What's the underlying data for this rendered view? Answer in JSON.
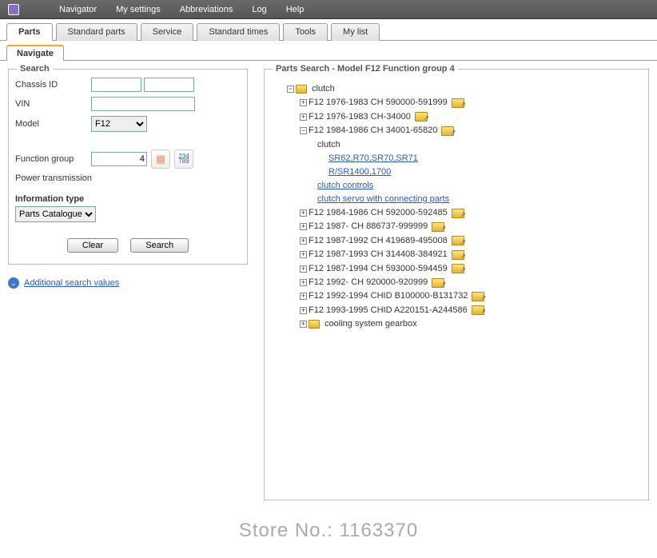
{
  "topMenu": [
    "Navigator",
    "My settings",
    "Abbreviations",
    "Log",
    "Help"
  ],
  "mainTabs": [
    {
      "label": "Parts",
      "active": true
    },
    {
      "label": "Standard parts"
    },
    {
      "label": "Service"
    },
    {
      "label": "Standard times"
    },
    {
      "label": "Tools"
    },
    {
      "label": "My list"
    }
  ],
  "subTabs": [
    {
      "label": "Navigate",
      "active": true
    }
  ],
  "search": {
    "legend": "Search",
    "chassisLabel": "Chassis ID",
    "chassisA": "",
    "chassisB": "",
    "vinLabel": "VIN",
    "vinValue": "",
    "modelLabel": "Model",
    "modelValue": "F12",
    "funcGroupLabel": "Function group",
    "funcGroupValue": "4",
    "funcGroupDesc": "Power transmission",
    "infoTypeLabel": "Information type",
    "infoTypeValue": "Parts Catalogue",
    "clearBtn": "Clear",
    "searchBtn": "Search",
    "additionalLink": "Additional search values"
  },
  "partsSearch": {
    "title": "Parts Search - Model F12 Function group 4",
    "root": "clutch",
    "nodes": [
      {
        "exp": "+",
        "label": "F12 1976-1983 CH 590000-591999",
        "trail": true
      },
      {
        "exp": "+",
        "label": "F12 1976-1983 CH-34000",
        "trail": true
      },
      {
        "exp": "-",
        "label": "F12 1984-1986 CH 34001-65820",
        "trail": true,
        "children": {
          "heading": "clutch",
          "links": [
            "SR62,R70,SR70,SR71",
            "R/SR1400,1700"
          ],
          "sub": [
            "clutch controls",
            "clutch servo with connecting parts"
          ]
        }
      },
      {
        "exp": "+",
        "label": "F12 1984-1986 CH 592000-592485",
        "trail": true
      },
      {
        "exp": "+",
        "label": "F12 1987- CH 886737-999999",
        "trail": true
      },
      {
        "exp": "+",
        "label": "F12 1987-1992 CH 419689-495008",
        "trail": true
      },
      {
        "exp": "+",
        "label": "F12 1987-1993 CH 314408-384921",
        "trail": true
      },
      {
        "exp": "+",
        "label": "F12 1987-1994 CH 593000-594459",
        "trail": true
      },
      {
        "exp": "+",
        "label": "F12 1992- CH 920000-920999",
        "trail": true
      },
      {
        "exp": "+",
        "label": "F12 1992-1994 CHID B100000-B131732",
        "trail": true
      },
      {
        "exp": "+",
        "label": "F12 1993-1995 CHID A220151-A244586",
        "trail": true
      },
      {
        "exp": "+",
        "label": "cooling system gearbox",
        "star": true
      }
    ]
  },
  "watermark": "Store No.: 1163370"
}
